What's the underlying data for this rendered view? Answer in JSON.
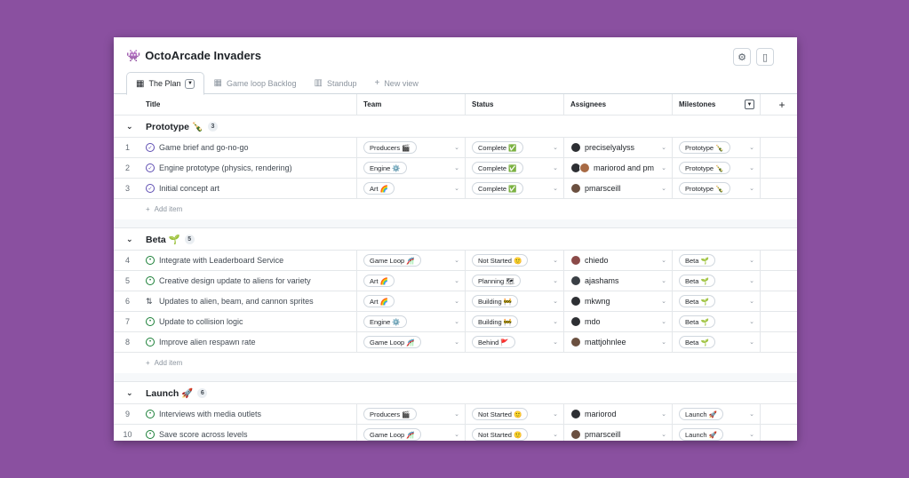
{
  "app": {
    "title": "OctoArcade Invaders",
    "title_icon": "👾",
    "settings_icon": "⚙",
    "panel_icon": "▯"
  },
  "tabs": [
    {
      "label": "The Plan",
      "icon": "▦",
      "active": true
    },
    {
      "label": "Game loop Backlog",
      "icon": "▦",
      "active": false
    },
    {
      "label": "Standup",
      "icon": "▥",
      "active": false
    },
    {
      "label": "New view",
      "icon": "+",
      "active": false
    }
  ],
  "columns": {
    "title": "Title",
    "team": "Team",
    "status": "Status",
    "assignees": "Assignees",
    "milestones": "Milestones",
    "add": "+"
  },
  "groups": [
    {
      "name": "Prototype 🍾",
      "count": "3",
      "items": [
        {
          "num": "1",
          "title": "Game brief and go-no-go",
          "type": "done",
          "team": "Producers 🎬",
          "status": "Complete ✅",
          "assignee": "preciselyalyss",
          "milestone": "Prototype 🍾"
        },
        {
          "num": "2",
          "title": "Engine prototype (physics, rendering)",
          "type": "done",
          "team": "Engine ⚙️",
          "status": "Complete ✅",
          "assignee": "mariorod and pm",
          "milestone": "Prototype 🍾"
        },
        {
          "num": "3",
          "title": "Initial concept art",
          "type": "done",
          "team": "Art 🌈",
          "status": "Complete ✅",
          "assignee": "pmarsceill",
          "milestone": "Prototype 🍾"
        }
      ],
      "add_label": "Add item"
    },
    {
      "name": "Beta 🌱",
      "count": "5",
      "items": [
        {
          "num": "4",
          "title": "Integrate with Leaderboard Service",
          "type": "open",
          "team": "Game Loop 🎢",
          "status": "Not Started 🙂",
          "assignee": "chiedo",
          "milestone": "Beta 🌱"
        },
        {
          "num": "5",
          "title": "Creative design update to aliens for variety",
          "type": "open",
          "team": "Art 🌈",
          "status": "Planning 🗺",
          "assignee": "ajashams",
          "milestone": "Beta 🌱"
        },
        {
          "num": "6",
          "title": "Updates to alien, beam, and cannon sprites",
          "type": "pr",
          "team": "Art 🌈",
          "status": "Building 🚧",
          "assignee": "mkwng",
          "milestone": "Beta 🌱"
        },
        {
          "num": "7",
          "title": "Update to collision logic",
          "type": "open",
          "team": "Engine ⚙️",
          "status": "Building 🚧",
          "assignee": "mdo",
          "milestone": "Beta 🌱"
        },
        {
          "num": "8",
          "title": "Improve alien respawn rate",
          "type": "open",
          "team": "Game Loop 🎢",
          "status": "Behind 🚩",
          "assignee": "mattjohnlee",
          "milestone": "Beta 🌱"
        }
      ],
      "add_label": "Add item"
    },
    {
      "name": "Launch 🚀",
      "count": "6",
      "items": [
        {
          "num": "9",
          "title": "Interviews with media outlets",
          "type": "open",
          "team": "Producers 🎬",
          "status": "Not Started 🙂",
          "assignee": "mariorod",
          "milestone": "Launch 🚀"
        },
        {
          "num": "10",
          "title": "Save score across levels",
          "type": "open",
          "team": "Game Loop 🎢",
          "status": "Not Started 🙂",
          "assignee": "pmarsceill",
          "milestone": "Launch 🚀"
        }
      ]
    }
  ]
}
